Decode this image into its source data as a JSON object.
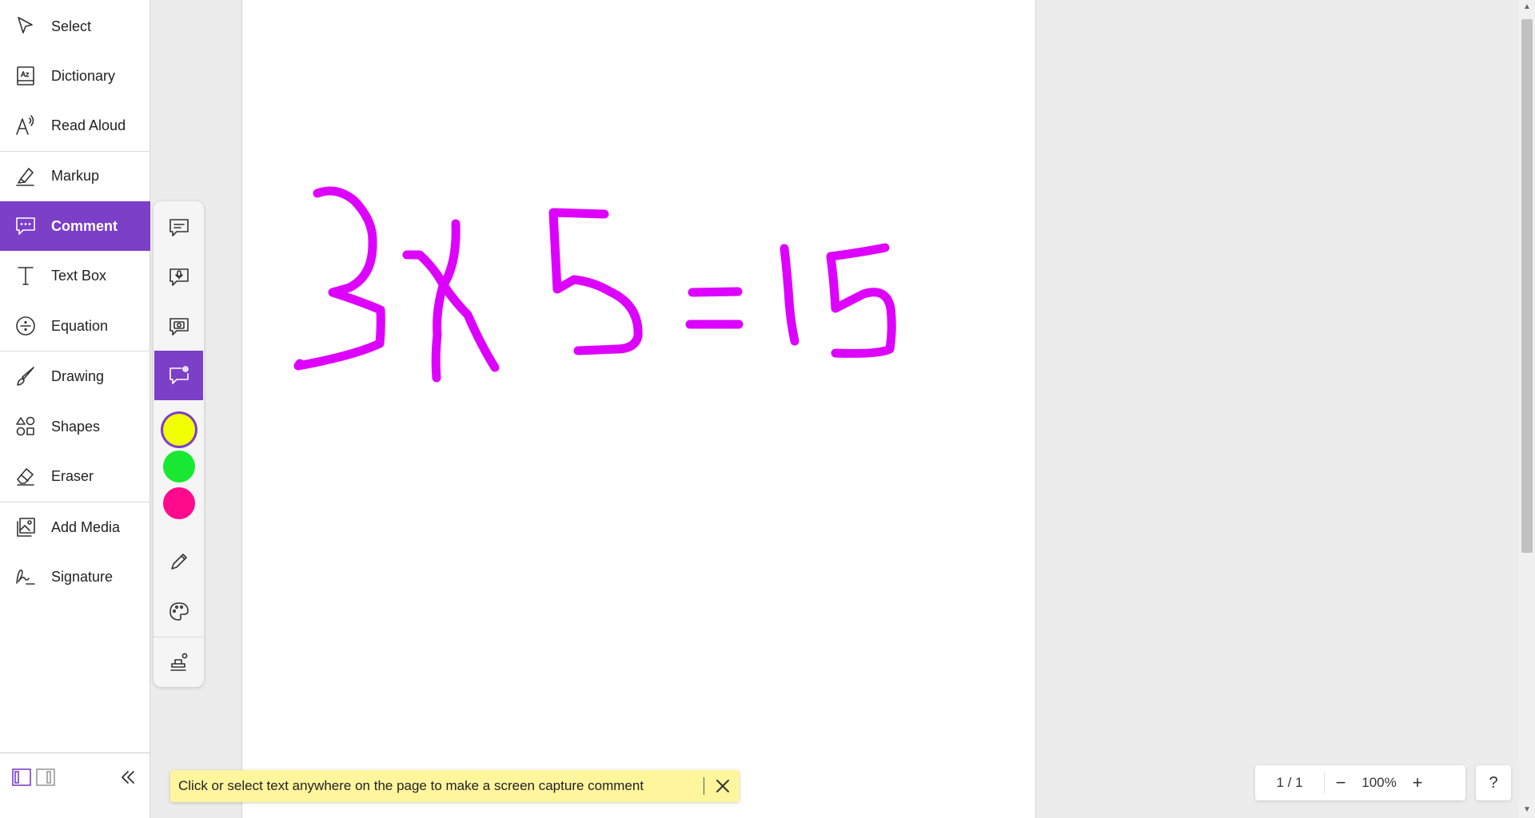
{
  "sidebar": {
    "items": [
      {
        "label": "Select",
        "icon": "cursor-icon"
      },
      {
        "label": "Dictionary",
        "icon": "dictionary-icon"
      },
      {
        "label": "Read Aloud",
        "icon": "read-aloud-icon"
      },
      {
        "label": "Markup",
        "icon": "highlighter-icon"
      },
      {
        "label": "Comment",
        "icon": "comment-icon",
        "active": true
      },
      {
        "label": "Text Box",
        "icon": "text-icon"
      },
      {
        "label": "Equation",
        "icon": "divide-icon"
      },
      {
        "label": "Drawing",
        "icon": "brush-icon"
      },
      {
        "label": "Shapes",
        "icon": "shapes-icon"
      },
      {
        "label": "Eraser",
        "icon": "eraser-icon"
      },
      {
        "label": "Add Media",
        "icon": "image-icon"
      },
      {
        "label": "Signature",
        "icon": "signature-icon"
      }
    ]
  },
  "comment_toolbar": {
    "tools": [
      "text-comment-icon",
      "voice-comment-icon",
      "video-comment-icon",
      "screen-capture-comment-icon"
    ],
    "active_tool": "screen-capture-comment-icon",
    "colors": [
      "#f2ff00",
      "#19e832",
      "#ff0a8c"
    ],
    "selected_color": "#f2ff00"
  },
  "drawing": {
    "ink_color": "#dd00ff",
    "content": "3x5=15"
  },
  "toast": {
    "message": "Click or select text anywhere on the page to make a screen capture comment"
  },
  "zoom": {
    "page": "1 / 1",
    "minus": "−",
    "level": "100%",
    "plus": "+"
  },
  "help": "?",
  "colors": {
    "accent": "#7b3fc8"
  }
}
